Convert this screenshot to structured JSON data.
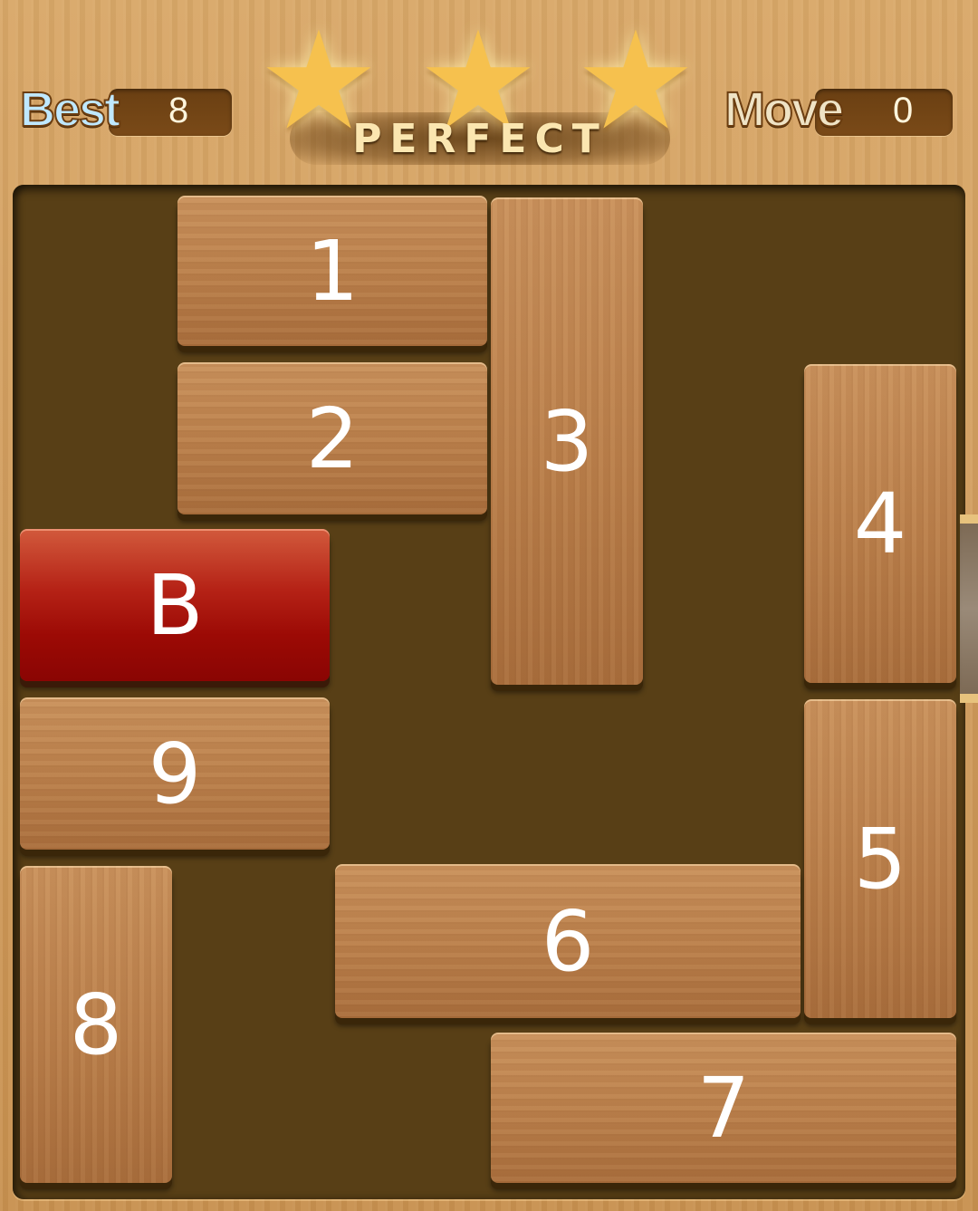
{
  "header": {
    "best_label": "Best",
    "best_value": "8",
    "move_label": "Move",
    "move_value": "0",
    "rating_text": "PERFECT",
    "stars_earned": 3,
    "stars_total": 3
  },
  "board": {
    "blocks": [
      {
        "label": "1",
        "orientation": "horizontal",
        "target": false
      },
      {
        "label": "2",
        "orientation": "horizontal",
        "target": false
      },
      {
        "label": "3",
        "orientation": "vertical",
        "target": false
      },
      {
        "label": "4",
        "orientation": "vertical",
        "target": false
      },
      {
        "label": "B",
        "orientation": "horizontal",
        "target": true
      },
      {
        "label": "9",
        "orientation": "horizontal",
        "target": false
      },
      {
        "label": "5",
        "orientation": "vertical",
        "target": false
      },
      {
        "label": "6",
        "orientation": "horizontal",
        "target": false
      },
      {
        "label": "8",
        "orientation": "vertical",
        "target": false
      },
      {
        "label": "7",
        "orientation": "horizontal",
        "target": false
      }
    ]
  },
  "colors": {
    "board_bg": "#583f16",
    "wood_block": "#b97e4a",
    "target_block": "#b52216",
    "star": "#f6c14e"
  },
  "icons": {
    "star": "star-icon"
  }
}
